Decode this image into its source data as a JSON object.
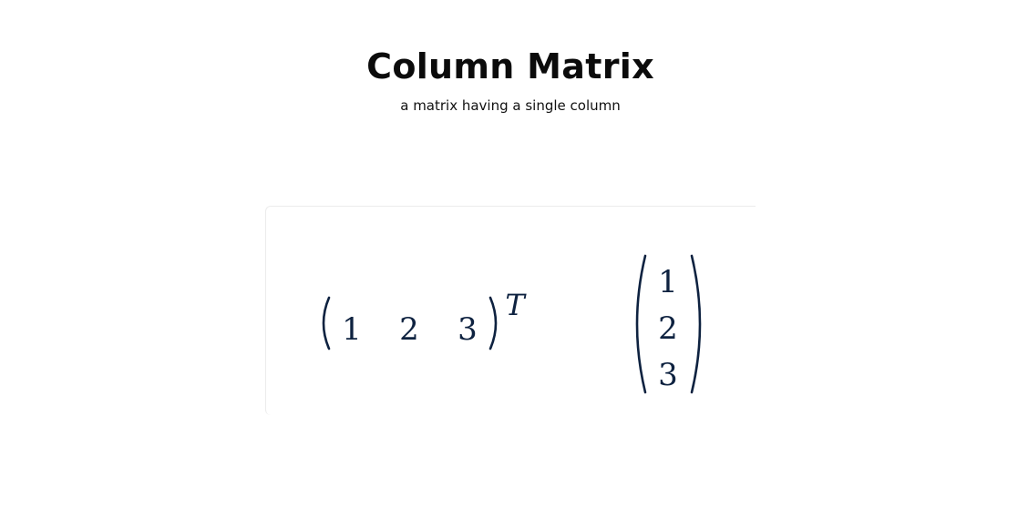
{
  "header": {
    "title": "Column Matrix",
    "subtitle": "a matrix having a single column"
  },
  "row_vector": {
    "entries": [
      "1",
      "2",
      "3"
    ],
    "superscript": "T"
  },
  "column_vector": {
    "entries": [
      "1",
      "2",
      "3"
    ]
  },
  "colors": {
    "math_ink": "#0e2240",
    "title": "#0b0b0b",
    "card_border": "#ececec"
  }
}
